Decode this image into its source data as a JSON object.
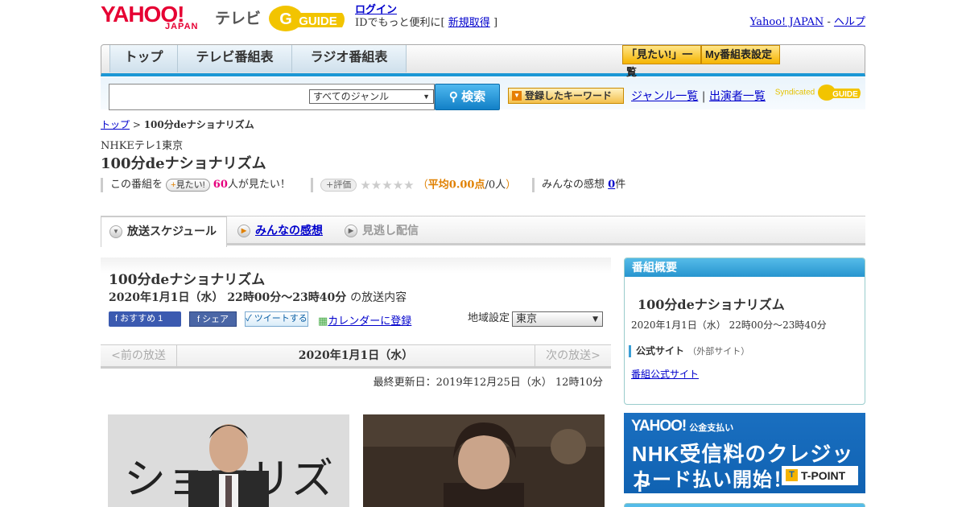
{
  "header": {
    "logo_yahoo": "YAHOO!",
    "logo_japan": "JAPAN",
    "logo_tv": "テレビ",
    "gguide_logo": "G-GUIDE",
    "login_label": "ログイン",
    "login_text": "IDでもっと便利に[",
    "signup_label": "新規取得",
    "signup_close": "]",
    "yahoo_japan_link": "Yahoo! JAPAN",
    "separator": "-",
    "help_link": "ヘルプ"
  },
  "nav": {
    "tabs": [
      {
        "label": "トップ"
      },
      {
        "label": "テレビ番組表"
      },
      {
        "label": "ラジオ番組表"
      }
    ],
    "mitai_list": "「見たい!」一覧",
    "my_bangumi": "My番組表設定"
  },
  "search": {
    "input_value": "",
    "genre": "すべてのジャンル",
    "button": "検索",
    "keyword_button": "登録したキーワード",
    "genre_list": "ジャンル一覧",
    "pipe": "|",
    "performer_list": "出演者一覧",
    "syndicated": "Syndicated"
  },
  "breadcrumb": {
    "top": "トップ",
    "sep": " > ",
    "current": "100分deナショナリズム"
  },
  "program": {
    "station": "NHKEテレ1東京",
    "title": "100分deナショナリズム",
    "mitai_prefix": "この番組を",
    "mitai_button": "見たい!",
    "mitai_count": "60",
    "mitai_suffix": "人が見たい！",
    "hyoka_button": "評価",
    "stars": "★★★★★",
    "rating_open": "（",
    "rating_avg_label": "平均",
    "rating_avg": "0.00点",
    "rating_people": "/0人",
    "rating_close": "）",
    "kansou_label": "みんなの感想",
    "kansou_count": "0",
    "kansou_unit": "件"
  },
  "tabs": [
    {
      "label": "放送スケジュール",
      "active": true
    },
    {
      "label": "みんなの感想",
      "active": false
    },
    {
      "label": "見逃し配信",
      "active": false
    }
  ],
  "broadcast": {
    "title": "100分deナショナリズム",
    "datetime": "2020年1月1日（水）  22時00分～23時40分",
    "suffix": "の放送内容",
    "fb_recommend": "おすすめ 1",
    "fb_share": "シェア",
    "tweet": "ツイートする",
    "calendar": "カレンダーに登録",
    "region_label": "地域設定",
    "region_value": "東京",
    "prev": "<前の放送",
    "current_date": "2020年1月1日（水）",
    "next": "次の放送>",
    "last_updated": "最終更新日：2019年12月25日（水）  12時10分",
    "photo1_text": "ショナリズ"
  },
  "sidebar": {
    "header": "番組概要",
    "title": "100分deナショナリズム",
    "datetime": "2020年1月1日（水）  22時00分～23時40分",
    "official_label": "公式サイト",
    "official_note": "（外部サイト）",
    "official_link": "番組公式サイト"
  },
  "banner": {
    "brand": "YAHOO!",
    "brand_sub": "公金支払い",
    "line1": "NHK受信料のクレジット",
    "line2": "カード払い開始！",
    "tpoint": "T-POINT",
    "tpoint_t": "T"
  }
}
